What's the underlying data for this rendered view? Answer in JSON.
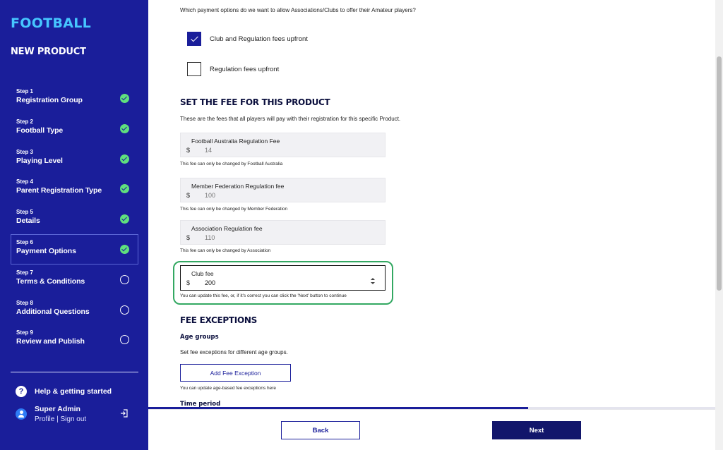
{
  "sidebar": {
    "brand": "FOOTBALL",
    "title": "NEW PRODUCT",
    "steps": [
      {
        "num": "Step 1",
        "name": "Registration Group",
        "status": "done"
      },
      {
        "num": "Step 2",
        "name": "Football Type",
        "status": "done"
      },
      {
        "num": "Step 3",
        "name": "Playing Level",
        "status": "done"
      },
      {
        "num": "Step 4",
        "name": "Parent Registration Type",
        "status": "done"
      },
      {
        "num": "Step 5",
        "name": "Details",
        "status": "done"
      },
      {
        "num": "Step 6",
        "name": "Payment Options",
        "status": "done"
      },
      {
        "num": "Step 7",
        "name": "Terms & Conditions",
        "status": "pending"
      },
      {
        "num": "Step 8",
        "name": "Additional Questions",
        "status": "pending"
      },
      {
        "num": "Step 9",
        "name": "Review and Publish",
        "status": "pending"
      }
    ],
    "active_step": 6,
    "help_label": "Help & getting started",
    "user": {
      "name": "Super Admin",
      "links": "Profile | Sign out"
    }
  },
  "payment": {
    "intro": "Which payment options do we want to allow Associations/Clubs to offer their Amateur players?",
    "options": [
      {
        "label": "Club and Regulation fees upfront",
        "checked": true
      },
      {
        "label": "Regulation fees upfront",
        "checked": false
      }
    ]
  },
  "fees": {
    "title": "SET THE FEE FOR THIS PRODUCT",
    "desc": "These are the fees that all players will pay with their registration for this specific Product.",
    "currency": "$",
    "items": [
      {
        "label": "Football Australia Regulation Fee",
        "value": "14",
        "help": "This fee can only be changed by Football Australia"
      },
      {
        "label": "Member Federation Regulation fee",
        "value": "100",
        "help": "This fee can only be changed by Member Federation"
      },
      {
        "label": "Association Regulation fee",
        "value": "110",
        "help": "This fee can only be changed by Association"
      }
    ],
    "club": {
      "label": "Club fee",
      "value": "200",
      "help": "You can update this fee, or, if it's correct you can click the 'Next' button to continue"
    }
  },
  "exceptions": {
    "title": "FEE EXCEPTIONS",
    "age_groups_title": "Age groups",
    "age_groups_desc": "Set fee exceptions for different age groups.",
    "add_button": "Add Fee Exception",
    "add_help": "You can update age-based fee exceptions here",
    "time_period_title": "Time period"
  },
  "progress": {
    "fraction": 0.67
  },
  "footer": {
    "back": "Back",
    "next": "Next"
  },
  "colors": {
    "brand": "#1a1e9a",
    "accent": "#46c6ff",
    "success": "#5fe07d",
    "highlight": "#33a862"
  }
}
